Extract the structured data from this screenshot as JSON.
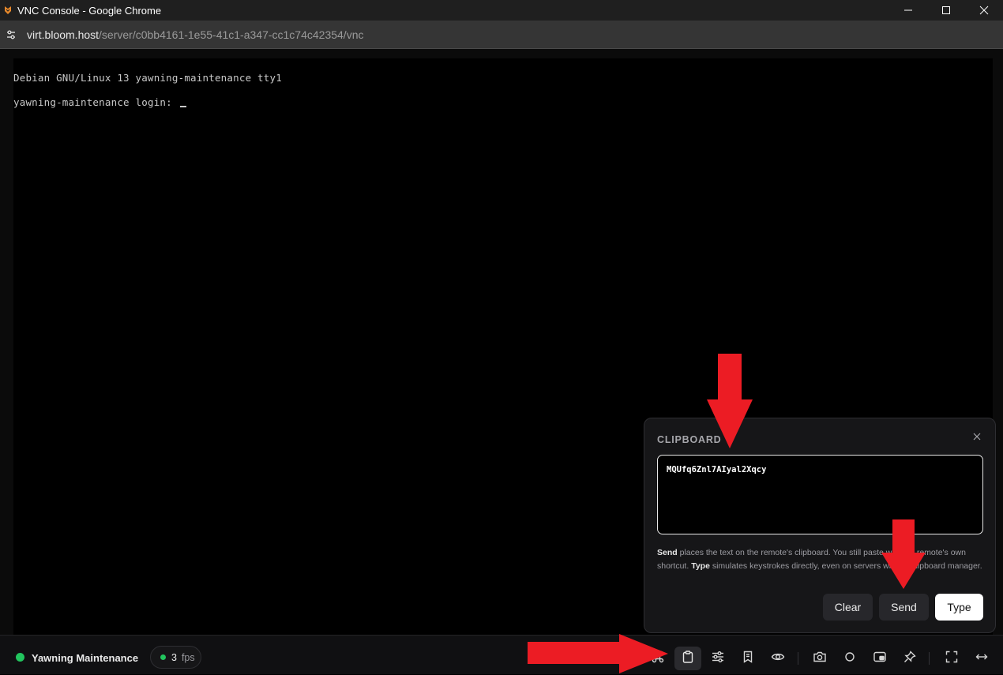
{
  "window": {
    "title": "VNC Console - Google Chrome"
  },
  "addressbar": {
    "host": "virt.bloom.host",
    "path": "/server/c0bb4161-1e55-41c1-a347-cc1c74c42354/vnc"
  },
  "console": {
    "line1": "Debian GNU/Linux 13 yawning-maintenance tty1",
    "line2": "yawning-maintenance login: "
  },
  "clipboard": {
    "heading": "CLIPBOARD",
    "text_value": "MQUfq6Znl7AIyal2Xqcy",
    "help_send_bold": "Send",
    "help_send_text": " places the text on the remote's clipboard. You still paste with the remote's own shortcut. ",
    "help_type_bold": "Type",
    "help_type_text": " simulates keystrokes directly, even on servers with no clipboard manager.",
    "clear_label": "Clear",
    "send_label": "Send",
    "type_label": "Type"
  },
  "bottombar": {
    "server_name": "Yawning Maintenance",
    "fps_value": "3",
    "fps_unit": "fps",
    "status_color": "#22c55e",
    "icons": [
      "command-icon",
      "clipboard-icon",
      "sliders-icon",
      "bookmark-icon",
      "eye-icon",
      "camera-icon",
      "circle-icon",
      "picture-in-picture-icon",
      "pin-icon",
      "fullscreen-icon",
      "resize-horizontal-icon"
    ]
  },
  "annotation": {
    "arrow_color": "#ec1c24"
  }
}
